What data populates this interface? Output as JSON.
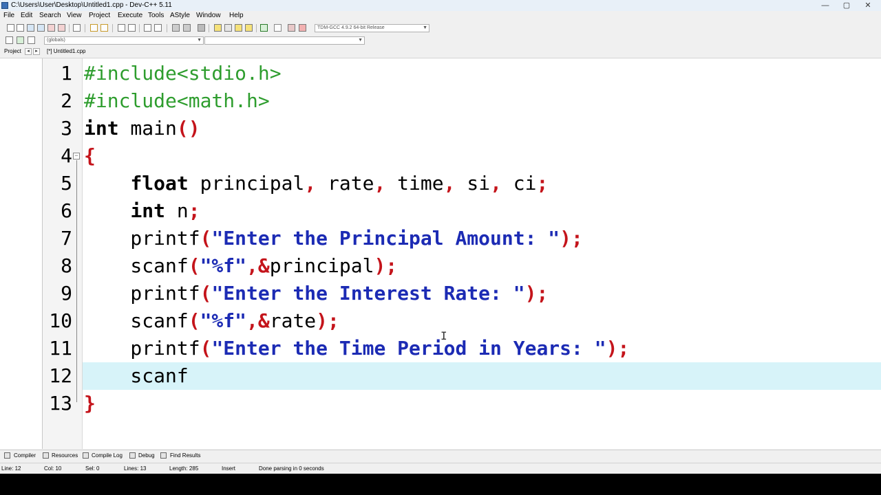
{
  "window": {
    "title": "C:\\Users\\User\\Desktop\\Untitled1.cpp - Dev-C++ 5.11",
    "controls": {
      "minimize": "—",
      "maximize": "▢",
      "close": "✕"
    }
  },
  "menu": [
    "File",
    "Edit",
    "Search",
    "View",
    "Project",
    "Execute",
    "Tools",
    "AStyle",
    "Window",
    "Help"
  ],
  "toolbar": {
    "compiler_select": "TDM-GCC 4.9.2 64-bit Release",
    "scope_select": "(globals)",
    "symbol_select": ""
  },
  "tabs": {
    "project_tab": "Project",
    "prev": "◂",
    "next": "▸",
    "file_tab": "[*] Untitled1.cpp"
  },
  "editor": {
    "lines": [
      {
        "num": "1",
        "tokens": [
          {
            "t": "#include<stdio.h>",
            "c": "pre"
          }
        ]
      },
      {
        "num": "2",
        "tokens": [
          {
            "t": "#include<math.h>",
            "c": "pre"
          }
        ]
      },
      {
        "num": "3",
        "tokens": [
          {
            "t": "int",
            "c": "kw"
          },
          {
            "t": " main",
            "c": "id"
          },
          {
            "t": "()",
            "c": "sym"
          }
        ]
      },
      {
        "num": "4",
        "tokens": [
          {
            "t": "{",
            "c": "sym"
          }
        ]
      },
      {
        "num": "5",
        "tokens": [
          {
            "t": "    ",
            "c": "id"
          },
          {
            "t": "float",
            "c": "kw"
          },
          {
            "t": " principal",
            "c": "id"
          },
          {
            "t": ",",
            "c": "sym"
          },
          {
            "t": " rate",
            "c": "id"
          },
          {
            "t": ",",
            "c": "sym"
          },
          {
            "t": " time",
            "c": "id"
          },
          {
            "t": ",",
            "c": "sym"
          },
          {
            "t": " si",
            "c": "id"
          },
          {
            "t": ",",
            "c": "sym"
          },
          {
            "t": " ci",
            "c": "id"
          },
          {
            "t": ";",
            "c": "sym"
          }
        ]
      },
      {
        "num": "6",
        "tokens": [
          {
            "t": "    ",
            "c": "id"
          },
          {
            "t": "int",
            "c": "kw"
          },
          {
            "t": " n",
            "c": "id"
          },
          {
            "t": ";",
            "c": "sym"
          }
        ]
      },
      {
        "num": "7",
        "tokens": [
          {
            "t": "    printf",
            "c": "id"
          },
          {
            "t": "(",
            "c": "sym"
          },
          {
            "t": "\"Enter the Principal Amount: \"",
            "c": "str"
          },
          {
            "t": ");",
            "c": "sym"
          }
        ]
      },
      {
        "num": "8",
        "tokens": [
          {
            "t": "    scanf",
            "c": "id"
          },
          {
            "t": "(",
            "c": "sym"
          },
          {
            "t": "\"%f\"",
            "c": "str"
          },
          {
            "t": ",&",
            "c": "sym"
          },
          {
            "t": "principal",
            "c": "id"
          },
          {
            "t": ");",
            "c": "sym"
          }
        ]
      },
      {
        "num": "9",
        "tokens": [
          {
            "t": "    printf",
            "c": "id"
          },
          {
            "t": "(",
            "c": "sym"
          },
          {
            "t": "\"Enter the Interest Rate: \"",
            "c": "str"
          },
          {
            "t": ");",
            "c": "sym"
          }
        ]
      },
      {
        "num": "10",
        "tokens": [
          {
            "t": "    scanf",
            "c": "id"
          },
          {
            "t": "(",
            "c": "sym"
          },
          {
            "t": "\"%f\"",
            "c": "str"
          },
          {
            "t": ",&",
            "c": "sym"
          },
          {
            "t": "rate",
            "c": "id"
          },
          {
            "t": ");",
            "c": "sym"
          }
        ]
      },
      {
        "num": "11",
        "tokens": [
          {
            "t": "    printf",
            "c": "id"
          },
          {
            "t": "(",
            "c": "sym"
          },
          {
            "t": "\"Enter the Time Period in Years: \"",
            "c": "str"
          },
          {
            "t": ");",
            "c": "sym"
          }
        ]
      },
      {
        "num": "12",
        "tokens": [
          {
            "t": "    scanf",
            "c": "id"
          }
        ]
      },
      {
        "num": "13",
        "tokens": [
          {
            "t": "}",
            "c": "sym"
          }
        ]
      }
    ],
    "active_line": 12
  },
  "bottom_tabs": [
    "Compiler",
    "Resources",
    "Compile Log",
    "Debug",
    "Find Results"
  ],
  "status": {
    "line": "Line:   12",
    "col": "Col:   10",
    "sel": "Sel:   0",
    "lines": "Lines:   13",
    "length": "Length:   285",
    "mode": "Insert",
    "message": "Done parsing in 0 seconds"
  },
  "colors": {
    "preprocessor": "#2e9d2e",
    "string": "#1c2bb4",
    "symbol": "#c4141b",
    "active_line": "#d7f3f9"
  }
}
